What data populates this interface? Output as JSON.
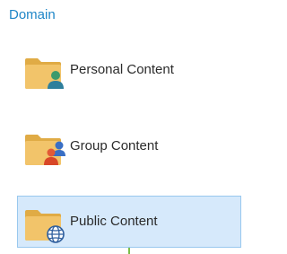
{
  "domain": {
    "title": "Domain",
    "items": [
      {
        "label": "Personal Content",
        "icon": "folder-person-icon",
        "selected": false
      },
      {
        "label": "Group Content",
        "icon": "folder-group-icon",
        "selected": false
      },
      {
        "label": "Public Content",
        "icon": "folder-globe-icon",
        "selected": true
      }
    ]
  },
  "colors": {
    "title": "#1f86c7",
    "folder": "#f2c46a",
    "folder_dark": "#e0ab45",
    "selection_bg": "#d6e9fb",
    "selection_border": "#99c8ee"
  }
}
